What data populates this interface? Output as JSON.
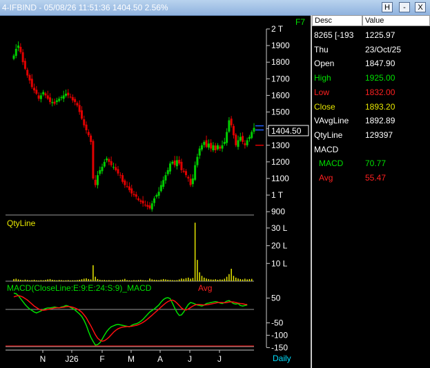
{
  "window": {
    "title": "4-IFBIND - 05/08/26 11:51:36 1404.50 2.56%",
    "buttons": [
      "H",
      "-",
      "X"
    ]
  },
  "chart_labels": {
    "shortcut": "F7",
    "last_price": "1404.50",
    "qty_title": "QtyLine",
    "macd_title": "MACD(CloseLine:E:9:E:24:S:9)_MACD",
    "macd_avg_title": "Avg",
    "period": "Daily"
  },
  "colors": {
    "up": "#00cc00",
    "down": "#e00000",
    "text": "#ffffff",
    "yellow": "#e8e800",
    "grid": "#9a9a9a",
    "macd": "#00e000",
    "avg": "#ff1010",
    "blue": "#2060ff"
  },
  "panel": {
    "header": {
      "desc": "Desc",
      "value": "Value"
    },
    "rows": [
      {
        "desc": "8265 [-193",
        "value": "1225.97",
        "color": "#ffffff"
      },
      {
        "desc": "Thu",
        "value": "23/Oct/25",
        "color": "#ffffff"
      },
      {
        "desc": "Open",
        "value": "1847.90",
        "color": "#ffffff"
      },
      {
        "desc": "High",
        "value": "1925.00",
        "color": "#00e000"
      },
      {
        "desc": "Low",
        "value": "1832.00",
        "color": "#ff2020"
      },
      {
        "desc": "Close",
        "value": "1893.20",
        "color": "#e8e800"
      },
      {
        "desc": "VAvgLine",
        "value": "1892.89",
        "color": "#ffffff"
      },
      {
        "desc": "QtyLine",
        "value": "129397",
        "color": "#ffffff"
      },
      {
        "desc": "MACD",
        "value": "",
        "color": "#ffffff"
      },
      {
        "desc": "MACD",
        "value": "70.77",
        "color": "#00e000",
        "indent": true
      },
      {
        "desc": "Avg",
        "value": "55.47",
        "color": "#ff2020",
        "indent": true
      }
    ]
  },
  "chart_data": [
    {
      "type": "candlestick",
      "ylim": [
        880,
        2000
      ],
      "y_ticks": [
        "2 T",
        "1900",
        "1800",
        "1700",
        "1600",
        "1500",
        "1400",
        "1300",
        "1200",
        "1100",
        "1 T",
        "900"
      ],
      "x_ticks": [
        "N",
        "J26",
        "F",
        "M",
        "A",
        "J",
        "J"
      ],
      "close_series": [
        1840,
        1880,
        1900,
        1860,
        1800,
        1760,
        1720,
        1690,
        1650,
        1630,
        1610,
        1580,
        1600,
        1620,
        1600,
        1580,
        1560,
        1560,
        1550,
        1570,
        1580,
        1590,
        1600,
        1610,
        1600,
        1590,
        1570,
        1560,
        1540,
        1500,
        1460,
        1420,
        1390,
        1360,
        1320,
        1100,
        1060,
        1120,
        1150,
        1170,
        1200,
        1220,
        1200,
        1180,
        1170,
        1150,
        1130,
        1120,
        1080,
        1060,
        1050,
        1030,
        1010,
        1000,
        990,
        970,
        960,
        950,
        940,
        930,
        920,
        950,
        980,
        1000,
        1020,
        1060,
        1090,
        1120,
        1150,
        1190,
        1200,
        1180,
        1210,
        1190,
        1150,
        1140,
        1120,
        1100,
        1060,
        1100,
        1180,
        1230,
        1280,
        1300,
        1320,
        1290,
        1310,
        1280,
        1300,
        1270,
        1300,
        1280,
        1300,
        1320,
        1380,
        1450,
        1420,
        1360,
        1300,
        1330,
        1350,
        1320,
        1300,
        1330,
        1350,
        1380,
        1404.5
      ]
    },
    {
      "type": "bar",
      "title": "QtyLine",
      "ylim": [
        0,
        35
      ],
      "y_ticks": [
        "30 L",
        "20 L",
        "10 L"
      ],
      "values": [
        1.2,
        1.4,
        1,
        0.8,
        0.6,
        0.9,
        0.7,
        0.5,
        0.6,
        0.8,
        0.5,
        0.4,
        0.6,
        0.5,
        0.7,
        1,
        1.2,
        0.8,
        0.6,
        0.5,
        0.7,
        0.6,
        0.4,
        0.5,
        0.6,
        0.4,
        0.5,
        0.5,
        0.6,
        0.8,
        1.1,
        1.4,
        1.6,
        1.2,
        1,
        9,
        2.5,
        1.2,
        0.8,
        0.6,
        0.7,
        0.5,
        0.6,
        0.4,
        0.5,
        0.6,
        0.5,
        0.7,
        0.9,
        1.3,
        0.6,
        0.5,
        0.4,
        0.6,
        0.5,
        0.7,
        0.8,
        0.6,
        0.5,
        0.4,
        1.5,
        1,
        0.8,
        0.7,
        0.6,
        0.9,
        1.2,
        1,
        0.8,
        0.7,
        0.6,
        0.5,
        0.6,
        1,
        1.5,
        1.3,
        1.7,
        2,
        1.4,
        1.8,
        33,
        12,
        5,
        3,
        2,
        1.5,
        1.2,
        1,
        0.9,
        1.1,
        0.8,
        1,
        0.9,
        1.4,
        2.5,
        4,
        7,
        3,
        2,
        1.5,
        1.2,
        1,
        1.4,
        1,
        1.2,
        1.3
      ]
    },
    {
      "type": "line",
      "title": "MACD(CloseLine:E:9:E:24:S:9)_MACD",
      "ylim": [
        -160,
        85
      ],
      "y_ticks": [
        "50",
        "-50",
        "-100",
        "-150"
      ],
      "series": [
        {
          "name": "MACD",
          "values": [
            70,
            68,
            60,
            48,
            36,
            24,
            14,
            6,
            0,
            -6,
            -10,
            -6,
            -2,
            4,
            8,
            10,
            10,
            12,
            14,
            12,
            10,
            14,
            16,
            20,
            18,
            12,
            8,
            2,
            -6,
            -14,
            -24,
            -40,
            -60,
            -85,
            -108,
            -125,
            -140,
            -138,
            -130,
            -116,
            -100,
            -85,
            -74,
            -66,
            -62,
            -58,
            -56,
            -58,
            -60,
            -62,
            -64,
            -66,
            -60,
            -56,
            -54,
            -50,
            -44,
            -36,
            -26,
            -16,
            -6,
            0,
            6,
            14,
            22,
            34,
            44,
            50,
            52,
            48,
            30,
            10,
            -8,
            -20,
            -18,
            -6,
            10,
            24,
            32,
            30,
            26,
            22,
            20,
            18,
            22,
            28,
            30,
            32,
            34,
            36,
            34,
            30,
            28,
            32,
            38,
            40,
            34,
            28,
            26,
            28,
            20,
            18,
            20,
            22
          ]
        },
        {
          "name": "Avg",
          "values": [
            55,
            58,
            60,
            58,
            54,
            48,
            42,
            34,
            26,
            18,
            12,
            6,
            2,
            1,
            2,
            4,
            6,
            8,
            10,
            11,
            11,
            12,
            13,
            15,
            16,
            15,
            13,
            10,
            6,
            0,
            -7,
            -18,
            -30,
            -46,
            -62,
            -80,
            -98,
            -112,
            -120,
            -124,
            -122,
            -116,
            -108,
            -98,
            -88,
            -80,
            -74,
            -70,
            -67,
            -66,
            -65,
            -65,
            -64,
            -62,
            -60,
            -57,
            -53,
            -48,
            -42,
            -35,
            -27,
            -19,
            -11,
            -3,
            5,
            14,
            22,
            30,
            36,
            40,
            42,
            38,
            30,
            20,
            10,
            4,
            2,
            6,
            12,
            18,
            22,
            24,
            24,
            23,
            22,
            23,
            24,
            26,
            28,
            30,
            32,
            32,
            32,
            31,
            32,
            34,
            35,
            34,
            32,
            30,
            28,
            27,
            25,
            24
          ]
        }
      ]
    }
  ]
}
